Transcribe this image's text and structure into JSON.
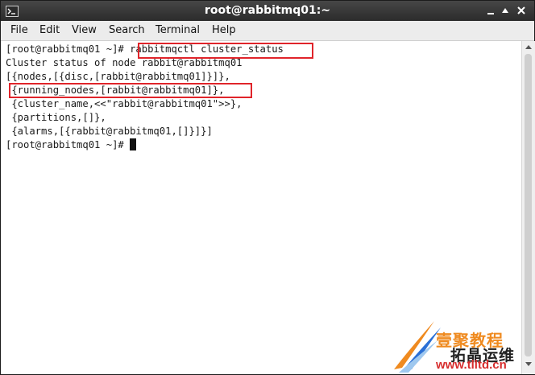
{
  "window": {
    "title": "root@rabbitmq01:~",
    "icon": "terminal-icon"
  },
  "menu": {
    "items": [
      "File",
      "Edit",
      "View",
      "Search",
      "Terminal",
      "Help"
    ]
  },
  "terminal": {
    "lines": [
      {
        "prompt": "[root@rabbitmq01 ~]# ",
        "text": "rabbitmqctl cluster_status"
      },
      {
        "text": "Cluster status of node rabbit@rabbitmq01"
      },
      {
        "text": "[{nodes,[{disc,[rabbit@rabbitmq01]}]},"
      },
      {
        "text": " {running_nodes,[rabbit@rabbitmq01]},"
      },
      {
        "text": " {cluster_name,<<\"rabbit@rabbitmq01\">>},"
      },
      {
        "text": " {partitions,[]},"
      },
      {
        "text": " {alarms,[{rabbit@rabbitmq01,[]}]}]"
      },
      {
        "prompt": "[root@rabbitmq01 ~]# ",
        "text": ""
      }
    ],
    "highlight_color": "#e0242a"
  },
  "watermark": {
    "line1": "壹聚教程",
    "line2": "拓晶运维",
    "url": "www.tlltd.cn",
    "colors": [
      "#ef8a1f",
      "#2a6fd6",
      "#d72d2d"
    ]
  }
}
